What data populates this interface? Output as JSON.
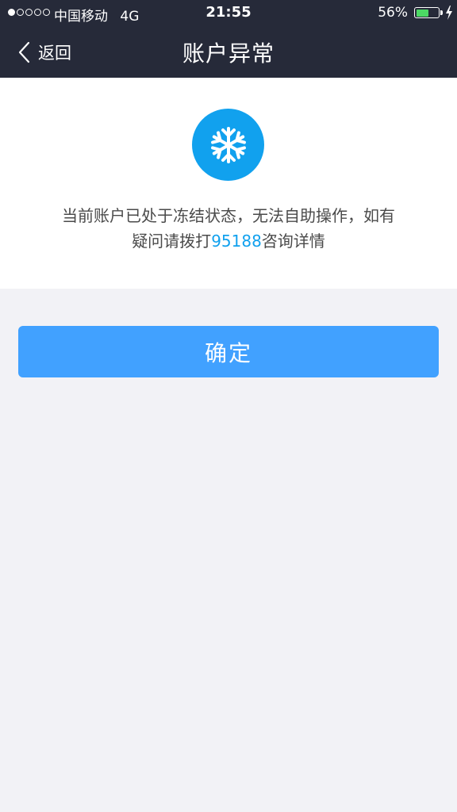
{
  "status_bar": {
    "carrier": "中国移动",
    "network": "4G",
    "time": "21:55",
    "battery_percent": "56%",
    "battery_level": 0.56,
    "signal_bars_filled": 1,
    "signal_bars_total": 5,
    "battery_color": "#4cd964"
  },
  "nav": {
    "back_label": "返回",
    "back_icon": "chevron-left-icon",
    "title": "账户异常",
    "background": "#262a39"
  },
  "notice": {
    "icon": "snowflake-icon",
    "icon_color": "#11a1ee",
    "line1": "当前账户已处于冻结状态，无法自助操作，如有",
    "line2_prefix": "疑问请拨打",
    "phone": "95188",
    "line2_suffix": "咨询详情"
  },
  "confirm_button": {
    "label": "确定",
    "color": "#41a1ff"
  }
}
